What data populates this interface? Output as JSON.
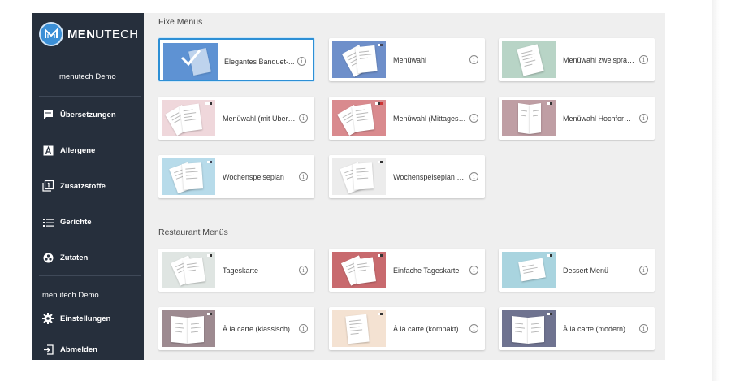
{
  "brand": {
    "name_bold": "MENU",
    "name_rest": "TECH"
  },
  "sidebar": {
    "user": "menutech Demo",
    "items": [
      {
        "label": "Übersetzungen",
        "icon": "translations-icon"
      },
      {
        "label": "Allergene",
        "icon": "allergens-icon"
      },
      {
        "label": "Zusatzstoffe",
        "icon": "additives-icon"
      },
      {
        "label": "Gerichte",
        "icon": "dishes-list-icon"
      },
      {
        "label": "Zutaten",
        "icon": "ingredients-icon"
      }
    ],
    "account_section": "menutech Demo",
    "account_items": [
      {
        "label": "Einstellungen",
        "icon": "gear-icon"
      },
      {
        "label": "Abmelden",
        "icon": "logout-icon"
      }
    ]
  },
  "sections": [
    {
      "title": "Fixe Menüs",
      "cards": [
        {
          "label": "Elegantes Banquet-...",
          "thumb_color": "#5e92d3",
          "selected": true
        },
        {
          "label": "Menüwahl",
          "thumb_color": "#6e8fca"
        },
        {
          "label": "Menüwahl zweisprachig",
          "thumb_color": "#b8d4c6"
        },
        {
          "label": "Menüwahl (mit Übers...",
          "thumb_color": "#efd7db"
        },
        {
          "label": "Menüwahl (Mittagess...",
          "thumb_color": "#d98a8e"
        },
        {
          "label": "Menüwahl Hochformat",
          "thumb_color": "#bf9ea4"
        },
        {
          "label": "Wochenspeiseplan",
          "thumb_color": "#b7dbea"
        },
        {
          "label": "Wochenspeiseplan (ei...",
          "thumb_color": "#ececec"
        }
      ]
    },
    {
      "title": "Restaurant Menüs",
      "cards": [
        {
          "label": "Tageskarte",
          "thumb_color": "#dfe5e2"
        },
        {
          "label": "Einfache Tageskarte",
          "thumb_color": "#c86a6e"
        },
        {
          "label": "Dessert Menü",
          "thumb_color": "#a9d4df"
        },
        {
          "label": "À la carte (klassisch)",
          "thumb_color": "#9d8a90"
        },
        {
          "label": "À la carte (kompakt)",
          "thumb_color": "#f4e2d2"
        },
        {
          "label": "À la carte (modern)",
          "thumb_color": "#6f7390"
        }
      ]
    }
  ],
  "info_glyph": "i",
  "colors": {
    "sidebar_bg": "#262f3c",
    "accent": "#2d8fd5",
    "content_bg": "#efefef"
  }
}
